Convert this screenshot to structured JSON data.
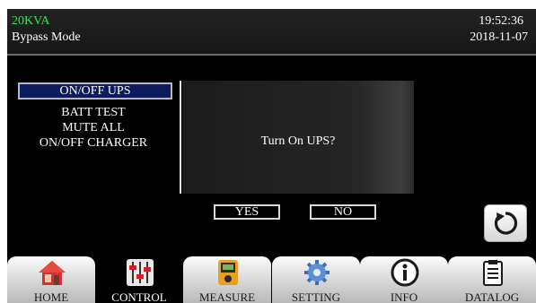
{
  "header": {
    "model": "20KVA",
    "mode": "Bypass Mode",
    "time": "19:52:36",
    "date": "2018-11-07"
  },
  "menu": {
    "items": [
      {
        "label": "ON/OFF UPS",
        "selected": true
      },
      {
        "label": "BATT TEST",
        "selected": false
      },
      {
        "label": "MUTE ALL",
        "selected": false
      },
      {
        "label": "ON/OFF CHARGER",
        "selected": false
      }
    ]
  },
  "dialog": {
    "message": "Turn On UPS?",
    "yes_label": "YES",
    "no_label": "NO"
  },
  "back_button": {
    "icon": "refresh-back-icon"
  },
  "nav": {
    "active": "CONTROL",
    "tabs": [
      {
        "label": "HOME",
        "icon": "home-icon"
      },
      {
        "label": "CONTROL",
        "icon": "sliders-icon"
      },
      {
        "label": "MEASURE",
        "icon": "meter-icon"
      },
      {
        "label": "SETTING",
        "icon": "gear-icon"
      },
      {
        "label": "INFO",
        "icon": "info-icon"
      },
      {
        "label": "DATALOG",
        "icon": "clipboard-icon"
      }
    ]
  },
  "colors": {
    "model_text": "#33e84a",
    "selected_item_bg": "#0d1c5f",
    "screen_bg": "#000000"
  }
}
